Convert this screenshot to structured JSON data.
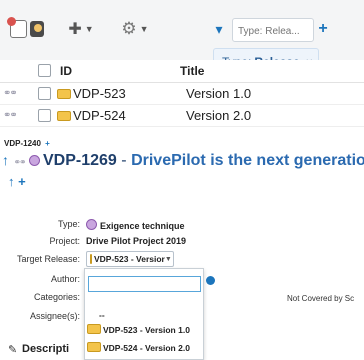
{
  "toolbar": {
    "type_dropdown_arrow": "▾",
    "filter_placeholder": "Type: Relea...",
    "filter_tooltip": {
      "prefix": "Type:",
      "value": "Release",
      "remove": "×"
    },
    "add_label": "+"
  },
  "table": {
    "columns": {
      "id": "ID",
      "title": "Title"
    },
    "rows": [
      {
        "id": "VDP-523",
        "title": "Version 1.0"
      },
      {
        "id": "VDP-524",
        "title": "Version 2.0"
      }
    ]
  },
  "detail": {
    "parent_id": "VDP-1240",
    "parent_add": "+",
    "item_id": "VDP-1269",
    "separator": "-",
    "item_title": "DrivePilot is the next generation",
    "up_arrow": "↑",
    "fields": {
      "type_label": "Type:",
      "type_value": "Exigence technique",
      "project_label": "Project:",
      "project_value": "Drive Pilot Project 2019",
      "target_release_label": "Target Release:",
      "target_release_value": "VDP-523 - Versior",
      "author_label": "Author:",
      "categories_label": "Categories:",
      "assignees_label": "Assignee(s):"
    },
    "dropdown": {
      "empty_option": "--",
      "options": [
        "VDP-523 - Version 1.0",
        "VDP-524 - Version 2.0"
      ]
    },
    "not_covered_text": "Not Covered by Sc",
    "description_label": "Descripti"
  },
  "colors": {
    "accent_blue": "#1c75bc",
    "link_blue": "#2b6ab0",
    "heading_navy": "#1f3f6b",
    "release_yellow": "#f3c44b",
    "toolbar_bg": "#f4f5f6"
  }
}
